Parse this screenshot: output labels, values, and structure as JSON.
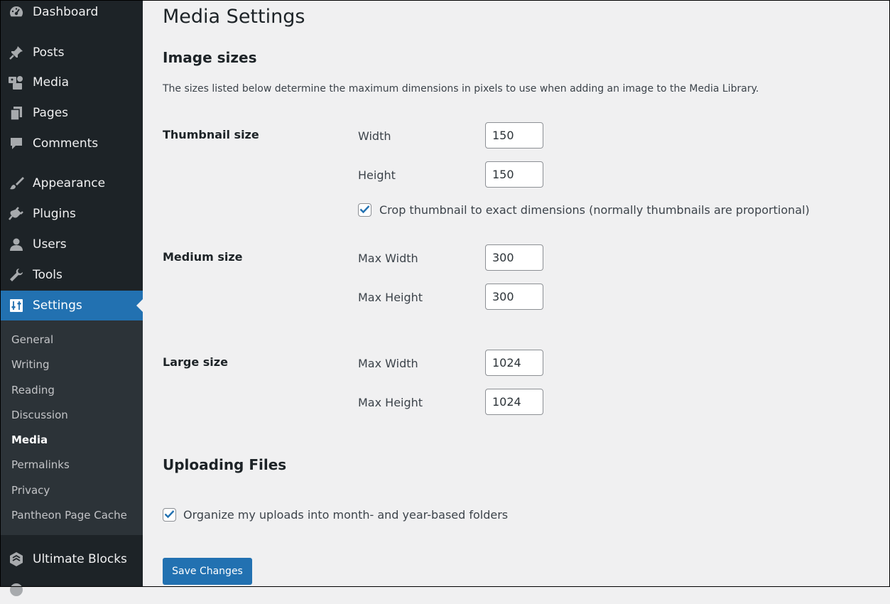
{
  "sidebar": {
    "menu": [
      {
        "label": "Dashboard",
        "icon": "dashboard-icon"
      },
      {
        "label": "Posts",
        "icon": "pin-icon"
      },
      {
        "label": "Media",
        "icon": "media-icon"
      },
      {
        "label": "Pages",
        "icon": "pages-icon"
      },
      {
        "label": "Comments",
        "icon": "comment-icon"
      },
      {
        "label": "Appearance",
        "icon": "brush-icon"
      },
      {
        "label": "Plugins",
        "icon": "plug-icon"
      },
      {
        "label": "Users",
        "icon": "user-icon"
      },
      {
        "label": "Tools",
        "icon": "wrench-icon"
      },
      {
        "label": "Settings",
        "icon": "settings-icon",
        "active": true
      }
    ],
    "submenu": [
      "General",
      "Writing",
      "Reading",
      "Discussion",
      "Media",
      "Permalinks",
      "Privacy",
      "Pantheon Page Cache"
    ],
    "submenu_current": "Media",
    "extra": {
      "label": "Ultimate Blocks",
      "icon": "ultimate-blocks-icon"
    }
  },
  "page": {
    "title": "Media Settings",
    "image_sizes": {
      "heading": "Image sizes",
      "description": "The sizes listed below determine the maximum dimensions in pixels to use when adding an image to the Media Library.",
      "thumbnail": {
        "label": "Thumbnail size",
        "width_label": "Width",
        "width_value": "150",
        "height_label": "Height",
        "height_value": "150",
        "crop_label": "Crop thumbnail to exact dimensions (normally thumbnails are proportional)",
        "crop_checked": true
      },
      "medium": {
        "label": "Medium size",
        "width_label": "Max Width",
        "width_value": "300",
        "height_label": "Max Height",
        "height_value": "300"
      },
      "large": {
        "label": "Large size",
        "width_label": "Max Width",
        "width_value": "1024",
        "height_label": "Max Height",
        "height_value": "1024"
      }
    },
    "uploading": {
      "heading": "Uploading Files",
      "organize_label": "Organize my uploads into month- and year-based folders",
      "organize_checked": true
    },
    "save_label": "Save Changes"
  },
  "colors": {
    "sidebar_bg": "#1d2327",
    "submenu_bg": "#2c3338",
    "accent": "#2271b1",
    "page_bg": "#f0f0f1"
  }
}
